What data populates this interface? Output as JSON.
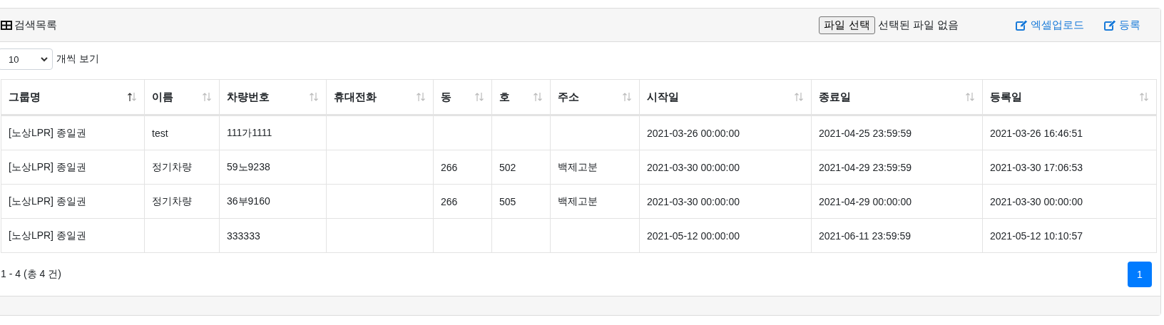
{
  "card_header": {
    "title": "검색목록",
    "file_button": "파일 선택",
    "file_status": "선택된 파일 없음",
    "actions": [
      {
        "label": "엑셀업로드"
      },
      {
        "label": "등록"
      }
    ]
  },
  "page_size": {
    "value": "10",
    "label": "개씩 보기"
  },
  "table": {
    "columns": [
      {
        "label": "그룹명",
        "sorted": true
      },
      {
        "label": "이름",
        "sorted": false
      },
      {
        "label": "차량번호",
        "sorted": false
      },
      {
        "label": "휴대전화",
        "sorted": false
      },
      {
        "label": "동",
        "sorted": false
      },
      {
        "label": "호",
        "sorted": false
      },
      {
        "label": "주소",
        "sorted": false
      },
      {
        "label": "시작일",
        "sorted": false
      },
      {
        "label": "종료일",
        "sorted": false
      },
      {
        "label": "등록일",
        "sorted": false
      }
    ],
    "rows": [
      [
        "[노상LPR] 종일권",
        "test",
        "111가1111",
        "",
        "",
        "",
        "",
        "2021-03-26 00:00:00",
        "2021-04-25 23:59:59",
        "2021-03-26 16:46:51"
      ],
      [
        "[노상LPR] 종일권",
        "정기차량",
        "59노9238",
        "",
        "266",
        "502",
        "백제고분",
        "2021-03-30 00:00:00",
        "2021-04-29 23:59:59",
        "2021-03-30 17:06:53"
      ],
      [
        "[노상LPR] 종일권",
        "정기차량",
        "36부9160",
        "",
        "266",
        "505",
        "백제고분",
        "2021-03-30 00:00:00",
        "2021-04-29 00:00:00",
        "2021-03-30 00:00:00"
      ],
      [
        "[노상LPR] 종일권",
        "",
        "333333",
        "",
        "",
        "",
        "",
        "2021-05-12 00:00:00",
        "2021-06-11 23:59:59",
        "2021-05-12 10:10:57"
      ]
    ]
  },
  "footer": {
    "summary": "1 - 4 (총 4 건)",
    "pages": [
      {
        "label": "1",
        "selected": true
      }
    ]
  }
}
